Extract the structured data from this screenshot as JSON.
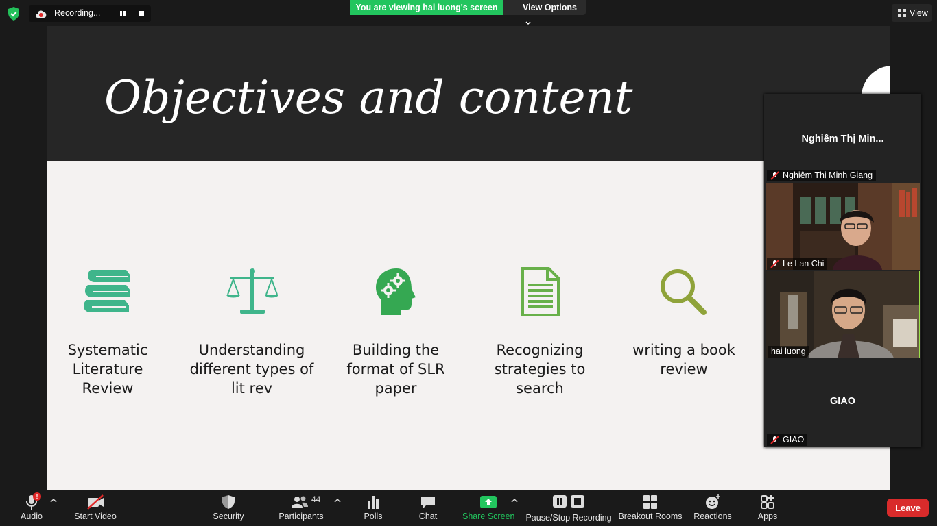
{
  "topbar": {
    "recording_label": "Recording...",
    "viewing_banner": "You are viewing hai luong's screen",
    "view_options_label": "View Options",
    "view_label": "View"
  },
  "slide": {
    "title": "Objectives and content",
    "objectives": [
      {
        "label_lines": [
          "Systematic",
          "Literature",
          "Review"
        ],
        "icon": "books-icon",
        "color": "#3fb58b"
      },
      {
        "label_lines": [
          "Understanding",
          "different types of",
          "lit rev"
        ],
        "icon": "scales-icon",
        "color": "#3fb58b"
      },
      {
        "label_lines": [
          "Building the",
          "format of SLR",
          "paper"
        ],
        "icon": "brain-gears-icon",
        "color": "#35a852"
      },
      {
        "label_lines": [
          "Recognizing",
          "strategies to",
          "search"
        ],
        "icon": "document-icon",
        "color": "#68b04a"
      },
      {
        "label_lines": [
          "writing a book",
          "review"
        ],
        "icon": "magnifier-icon",
        "color": "#8fa33a"
      }
    ]
  },
  "participants": [
    {
      "display_name": "Nghiêm Thị Min...",
      "label": "Nghiêm Thị Minh Giang",
      "muted": true,
      "video": false
    },
    {
      "display_name": "",
      "label": "Le Lan Chi",
      "muted": true,
      "video": true
    },
    {
      "display_name": "",
      "label": "hai luong",
      "muted": false,
      "video": true,
      "active_speaker": true
    },
    {
      "display_name": "GIAO",
      "label": "GIAO",
      "muted": true,
      "video": false
    }
  ],
  "toolbar": {
    "audio": "Audio",
    "audio_alert": "!",
    "start_video": "Start Video",
    "security": "Security",
    "participants": "Participants",
    "participants_count": "44",
    "polls": "Polls",
    "chat": "Chat",
    "share_screen": "Share Screen",
    "pause_stop_recording": "Pause/Stop Recording",
    "breakout_rooms": "Breakout Rooms",
    "reactions": "Reactions",
    "apps": "Apps",
    "leave": "Leave"
  },
  "colors": {
    "share_green": "#22c55e",
    "leave_red": "#d92b2b",
    "active_speaker_border": "#9be14a"
  }
}
